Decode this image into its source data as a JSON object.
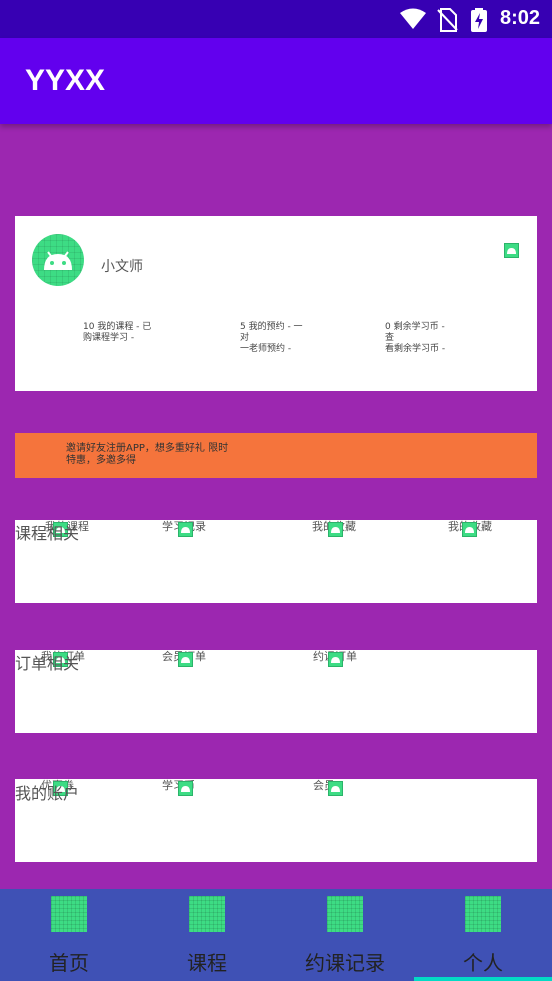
{
  "status_bar": {
    "time": "8:02",
    "icons": [
      "wifi-icon",
      "no-sim-icon",
      "battery-charging-icon"
    ]
  },
  "app_bar": {
    "title": "YYXX"
  },
  "profile": {
    "name": "小文师",
    "stats": [
      {
        "line1": "10 我的课程 - 已",
        "line2": "购课程学习 -"
      },
      {
        "line1": "5 我的预约 - 一对",
        "line2": "一老师预约 -"
      },
      {
        "line1": "0 剩余学习币 - 查",
        "line2": "看剩余学习币 -"
      }
    ]
  },
  "invite": {
    "line1": "邀请好友注册APP，想多重好礼 限时",
    "line2": "特惠，多邀多得"
  },
  "sections": [
    {
      "title": "课程相关",
      "items": [
        {
          "label": "我的课程"
        },
        {
          "label": "学习记录"
        },
        {
          "label": "我的收藏"
        },
        {
          "label": "我的收藏"
        }
      ]
    },
    {
      "title": "订单相关",
      "items": [
        {
          "label": "我的订单"
        },
        {
          "label": "会员订单"
        },
        {
          "label": "约课订单"
        }
      ]
    },
    {
      "title": "我的账户",
      "items": [
        {
          "label": "优惠券"
        },
        {
          "label": "学习币"
        },
        {
          "label": "会员"
        }
      ]
    }
  ],
  "bottom_nav": {
    "items": [
      {
        "label": "首页"
      },
      {
        "label": "课程"
      },
      {
        "label": "约课记录"
      },
      {
        "label": "个人"
      }
    ],
    "active_index": 3,
    "accent_color": "#03dac5"
  },
  "colors": {
    "status_bar": "#3700b3",
    "app_bar": "#6200ee",
    "background": "#9c27b0",
    "invite_bar": "#f5743c",
    "bottom_nav": "#3f51b5",
    "placeholder_icon": "#3ddc84"
  }
}
